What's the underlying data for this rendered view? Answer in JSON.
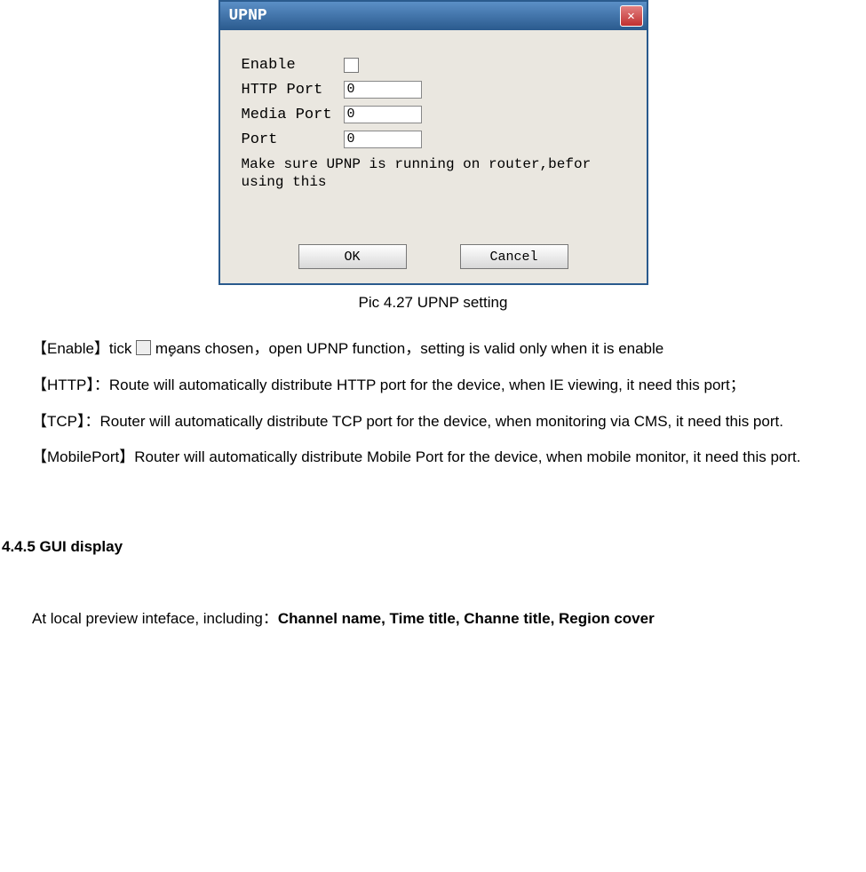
{
  "dialog": {
    "title": "UPNP",
    "close_glyph": "✕",
    "fields": {
      "enable_label": "Enable",
      "http_port_label": "HTTP Port",
      "media_port_label": "Media Port",
      "port_label": "Port",
      "http_port_value": "0",
      "media_port_value": "0",
      "port_value": "0"
    },
    "hint_line1": "Make sure UPNP is running on router,befor",
    "hint_line2": "using this",
    "ok_label": "OK",
    "cancel_label": "Cancel"
  },
  "caption": "Pic 4.27 UPNP setting",
  "enable_line_pre": "【Enable】tick ",
  "enable_line_post": "means chosen，open UPNP function，setting is valid only when it is enable",
  "http_line": "【HTTP】：Route will automatically distribute HTTP port for the device, when IE viewing, it need this port；",
  "tcp_line": "【TCP】：Router will automatically distribute TCP port for the device, when monitoring via CMS, it need this port.",
  "mobile_line": "【MobilePort】Router will automatically distribute Mobile Port for the device, when mobile monitor, it need this port.",
  "section_heading": "4.4.5 GUI display",
  "last_line_pre": "At local preview inteface, including：",
  "last_line_bold": "Channel name, Time title, Channe title, Region cover"
}
